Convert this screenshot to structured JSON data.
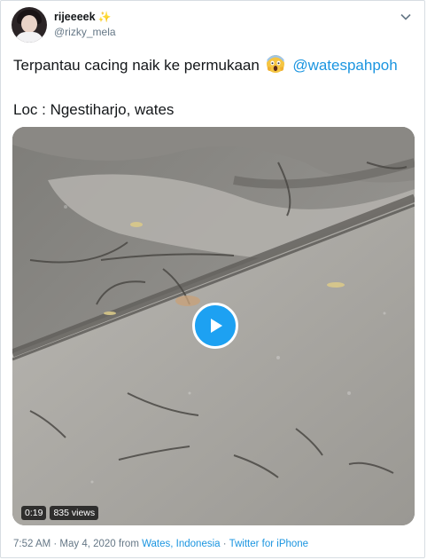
{
  "author": {
    "display_name": "rijeeeek",
    "handle": "@rizky_mela",
    "name_emoji": "sparkles-icon"
  },
  "tweet": {
    "text": "Terpantau cacing naik ke permukaan",
    "emoji": "face-screaming-in-fear-icon",
    "mention": "@watespahpoh",
    "location_line": "Loc : Ngestiharjo, wates"
  },
  "video": {
    "duration": "0:19",
    "views": "835 views",
    "play_icon": "play-icon"
  },
  "meta": {
    "timestamp": "7:52 AM · May 4, 2020",
    "from_label": "from",
    "place": "Wates, Indonesia",
    "separator": "·",
    "source": "Twitter for iPhone"
  },
  "colors": {
    "link": "#1b95e0",
    "play_button": "#1da1f2",
    "secondary_text": "#657786"
  }
}
